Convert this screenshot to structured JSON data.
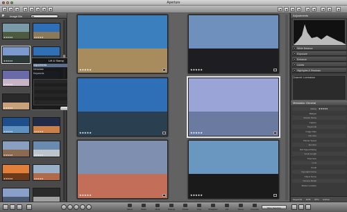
{
  "window": {
    "title": "Aperture"
  },
  "toolbar": {
    "button1": "",
    "button2": ""
  },
  "library": {
    "search_placeholder": "",
    "label": "Image Bin"
  },
  "popover": {
    "title": "Lift & Stamp",
    "rows": [
      "Adjustments",
      "Metadata",
      "Keywords"
    ],
    "button": "Lift & Stamp"
  },
  "adjustments": {
    "title": "Adjustments",
    "rows": [
      "White Balance",
      "Exposure",
      "Enhance",
      "Levels",
      "Highlights & Shadows"
    ],
    "box_label": "Channel: Luminance",
    "box2": "White Balance"
  },
  "metadata": {
    "title": "Metadata: General",
    "fields": [
      {
        "label": "Rating",
        "value": "★★★★★"
      },
      {
        "label": "Badges",
        "value": ""
      },
      {
        "label": "Version Name",
        "value": ""
      },
      {
        "label": "Caption",
        "value": ""
      },
      {
        "label": "Keywords",
        "value": ""
      },
      {
        "label": "Image Date",
        "value": ""
      },
      {
        "label": "File Size",
        "value": ""
      },
      {
        "label": "Shutter Speed",
        "value": ""
      },
      {
        "label": "Aperture",
        "value": ""
      },
      {
        "label": "ISO Speed Rating",
        "value": ""
      },
      {
        "label": "Focal Length",
        "value": ""
      },
      {
        "label": "Pixel Size",
        "value": ""
      },
      {
        "label": "Lens",
        "value": ""
      },
      {
        "label": "Credit",
        "value": ""
      },
      {
        "label": "Copyright Notice",
        "value": ""
      },
      {
        "label": "Object Name",
        "value": ""
      },
      {
        "label": "Camera Model",
        "value": ""
      },
      {
        "label": "Master Location",
        "value": ""
      }
    ],
    "tabs": [
      "Keywords",
      "EXIF",
      "IPTC",
      "Archive"
    ]
  },
  "main_images": [
    {
      "stars": "★★★★★",
      "sky": "#3c7fbf",
      "land": "#a88c5e"
    },
    {
      "stars": "★★★★★",
      "sky": "#6f8fbd",
      "land": "#1e1e22"
    },
    {
      "stars": "★★★★★",
      "sky": "#2f6fb8",
      "land": "#2a3f50"
    },
    {
      "stars": "★★★★★",
      "sky": "#9aa4d6",
      "land": "#6a7aa0"
    },
    {
      "stars": "★★★★★",
      "sky": "#7e8fb0",
      "land": "#c26e58"
    },
    {
      "stars": "★★★★★",
      "sky": "#6a97c0",
      "land": "#1a1a1a"
    }
  ],
  "thumbnails": [
    {
      "top": "#7a9aa8",
      "bottom": "#4d5a40",
      "stars": "★★★★★"
    },
    {
      "top": "#2f6fb8",
      "bottom": "#8a7a5a",
      "stars": "★★★★★"
    },
    {
      "top": "#7c9acc",
      "bottom": "#2c3a3a",
      "stars": "★★★★★"
    },
    {
      "top": "#3070b5",
      "bottom": "#223344",
      "stars": "★★★★★"
    },
    {
      "top": "#6a6aa8",
      "bottom": "#c9b5c8",
      "stars": "★★★★★"
    },
    {
      "top": "#3e6ea8",
      "bottom": "#223",
      "stars": "★★★★★"
    },
    {
      "top": "#2a2a2a",
      "bottom": "#c8a07a",
      "stars": "★★★★★"
    },
    {
      "top": "#3a3a3a",
      "bottom": "#555",
      "stars": "★★★★★"
    },
    {
      "top": "#1f4f8a",
      "bottom": "#6090c0",
      "stars": "★★★★★"
    },
    {
      "top": "#222c48",
      "bottom": "#c9804a",
      "stars": "★★★★★"
    },
    {
      "top": "#8aa0c0",
      "bottom": "#8a6a50",
      "stars": "★★★★★"
    },
    {
      "top": "#6a8ab0",
      "bottom": "#bcc4cc",
      "stars": "★★★★★"
    },
    {
      "top": "#e0803a",
      "bottom": "#6a3a1a",
      "stars": "★★★★★"
    },
    {
      "top": "#9ab0c8",
      "bottom": "#b06a4a",
      "stars": "★★★★★"
    },
    {
      "top": "#8aa0c8",
      "bottom": "#4a5a70",
      "stars": "★★★★★"
    },
    {
      "top": "#2a2a2a",
      "bottom": "#a0a0a0",
      "stars": "★★★★★"
    }
  ],
  "bottom_tools": [
    "Select",
    "Stack",
    "Mark",
    "Ratings",
    "Rotate",
    "Crop",
    "Straighten",
    "Lift",
    "Stamp",
    "Compare"
  ],
  "bottom_select": "More Selection"
}
